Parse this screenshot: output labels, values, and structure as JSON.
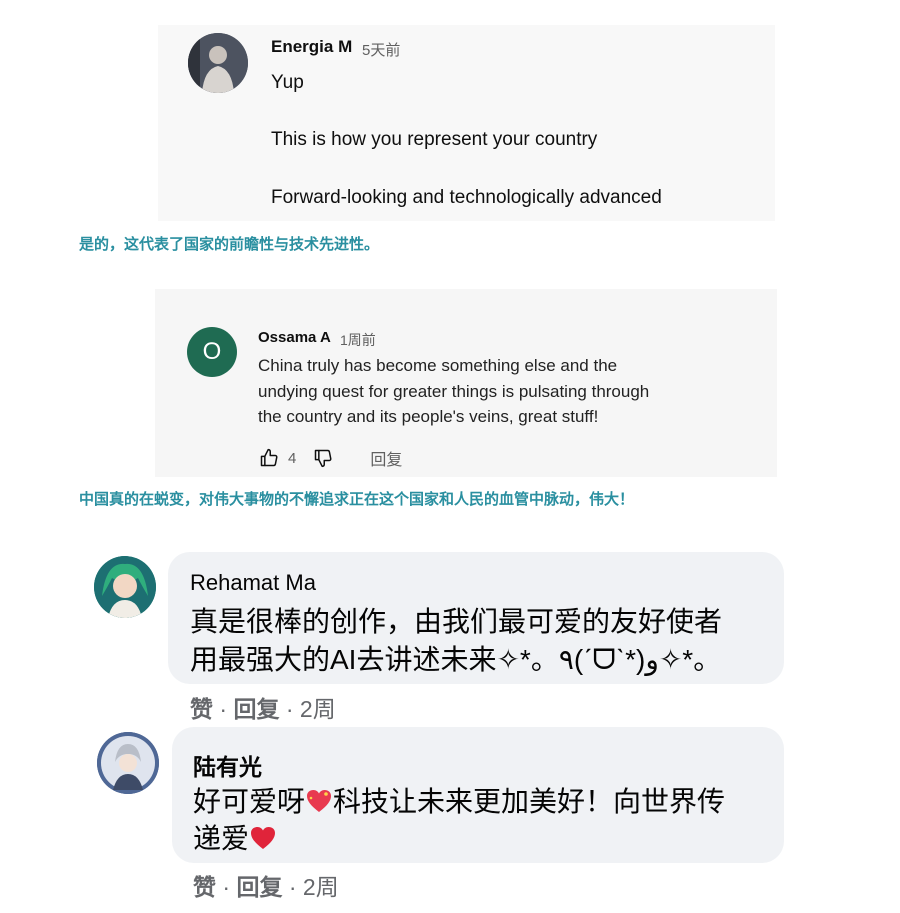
{
  "comment1": {
    "author": "Energia M",
    "time": "5天前",
    "lines": [
      "Yup",
      "This is how you represent your country",
      "Forward-looking and technologically advanced"
    ]
  },
  "translation1": "是的，这代表了国家的前瞻性与技术先进性。",
  "comment2": {
    "avatar_letter": "O",
    "author": "Ossama A",
    "time": "1周前",
    "lines": [
      "China truly has become something else and the",
      "undying quest for greater things is pulsating through",
      "the country and its people's veins, great stuff!"
    ],
    "like_count": "4",
    "reply_label": "回复",
    "colors": {
      "avatar": "#1f6b52"
    }
  },
  "translation2": "中国真的在蜕变，对伟大事物的不懈追求正在这个国家和人民的血管中脉动，伟大！",
  "comment3": {
    "author": "Rehamat Ma",
    "lines": [
      "真是很棒的创作，由我们最可爱的友好使者",
      "用最强大的AI去讲述未来✧*。٩(ˊᗜˋ*)و✧*。"
    ],
    "like_label": "赞",
    "reply_label": "回复",
    "time": "2周"
  },
  "comment4": {
    "author": "陆有光",
    "line1_before": "好可爱呀",
    "line1_after": "科技让未来更加美好！向世界传",
    "line2": "递爱",
    "like_label": "赞",
    "reply_label": "回复",
    "time": "2周"
  },
  "icons": {
    "like": "thumbs-up-icon",
    "dislike": "thumbs-down-icon",
    "heart": "heart-icon"
  }
}
